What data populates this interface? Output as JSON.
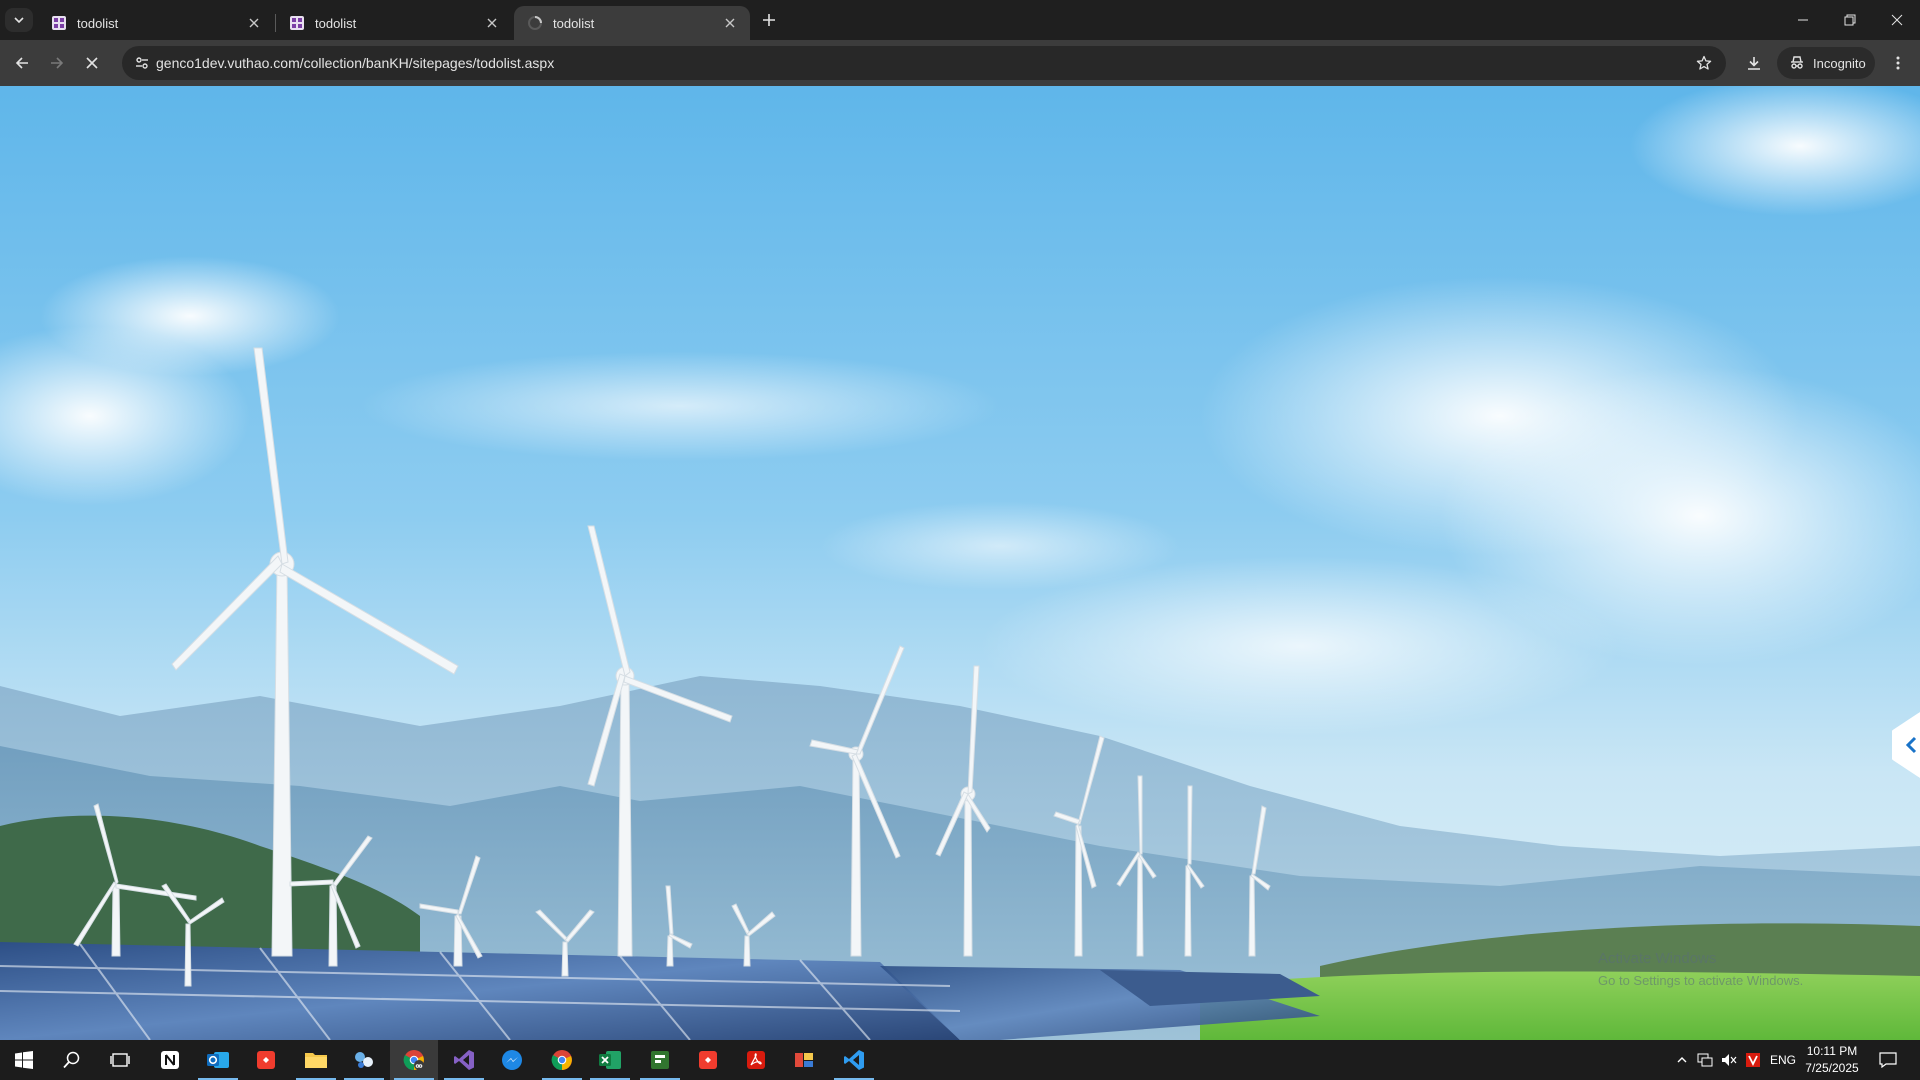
{
  "browser": {
    "tabs": [
      {
        "title": "todolist",
        "active": false
      },
      {
        "title": "todolist",
        "active": false
      },
      {
        "title": "todolist",
        "active": true
      }
    ],
    "url": "genco1dev.vuthao.com/collection/banKH/sitepages/todolist.aspx",
    "incognito_label": "Incognito"
  },
  "page": {
    "watermark_line1": "Activate Windows",
    "watermark_line2": "Go to Settings to activate Windows."
  },
  "taskbar": {
    "apps": [
      "start-icon",
      "search-icon",
      "task-view-icon",
      "notion-icon",
      "outlook-icon",
      "git-icon",
      "file-explorer-icon",
      "network-app-icon",
      "chrome-incognito-icon",
      "visual-studio-icon",
      "messenger-icon",
      "chrome-icon",
      "excel-icon",
      "project-icon",
      "git-gui-icon",
      "acrobat-icon",
      "app-icon",
      "vscode-icon"
    ],
    "language": "ENG",
    "time": "10:11 PM",
    "date": "7/25/2025"
  },
  "colors": {
    "tabstrip": "#1f1f1f",
    "toolbar": "#3c3c3c",
    "omnibox": "#282828",
    "taskbar": "#1c1c1c",
    "sky_top": "#5fb6ea",
    "grass": "#6cc24a"
  }
}
